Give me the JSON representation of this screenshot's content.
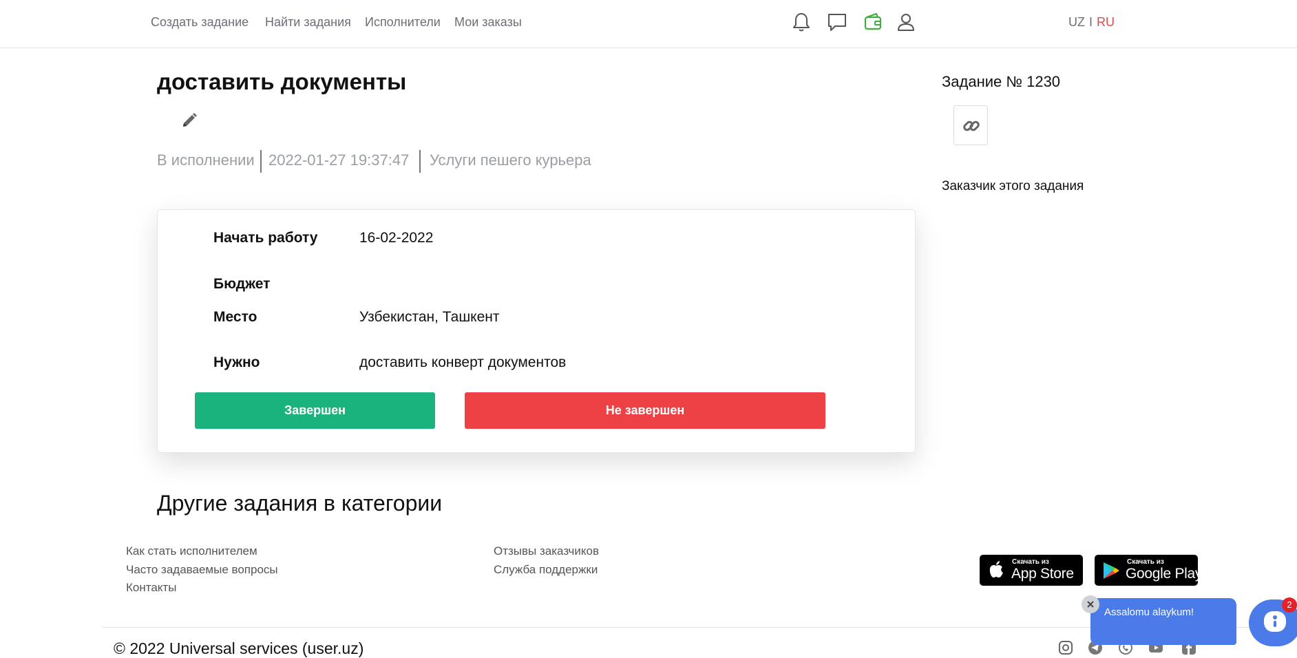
{
  "nav": {
    "items": [
      "Создать задание",
      "Найти задания",
      "Исполнители",
      "Мои заказы"
    ],
    "icons": [
      "bell-icon",
      "chat-icon",
      "wallet-icon",
      "user-icon"
    ],
    "wallet_color": "#3fae3f"
  },
  "lang": {
    "uz": "UZ",
    "separator": "I",
    "ru": "RU",
    "active_color": "#e04a4a"
  },
  "task": {
    "title": "доставить документы",
    "status": "В исполнении",
    "date": "2022-01-27 19:37:47",
    "category": "Услуги пешего курьера",
    "details": [
      {
        "label": "Начать работу",
        "value": "16-02-2022"
      },
      {
        "label": "Бюджет",
        "value": ""
      },
      {
        "label": "Место",
        "value": "Узбекистан, Ташкент"
      },
      {
        "label": "Нужно",
        "value": "доставить конверт документов"
      }
    ],
    "complete_label": "Завершен",
    "not_complete_label": "Не завершен",
    "complete_color": "#1ab37d",
    "not_complete_color": "#ee4145"
  },
  "sidebar": {
    "task_number": "Задание № 1230",
    "customer_label": "Заказчик этого задания"
  },
  "other_tasks_title": "Другие задания в категории",
  "footer": {
    "col1": [
      "Как стать исполнителем",
      "Часто задаваемые вопросы",
      "Контакты"
    ],
    "col2": [
      "Отзывы заказчиков",
      "Служба поддержки"
    ],
    "app_store": {
      "small": "Скачать из",
      "big": "App Store"
    },
    "google_play": {
      "small": "Скачать из",
      "big": "Google Play"
    },
    "copyright": "© 2022 Universal services (user.uz)",
    "social": [
      "instagram-icon",
      "telegram-icon",
      "phone-icon",
      "youtube-icon",
      "facebook-icon"
    ]
  },
  "chat": {
    "message": "Assalomu alaykum!",
    "badge": "2"
  }
}
